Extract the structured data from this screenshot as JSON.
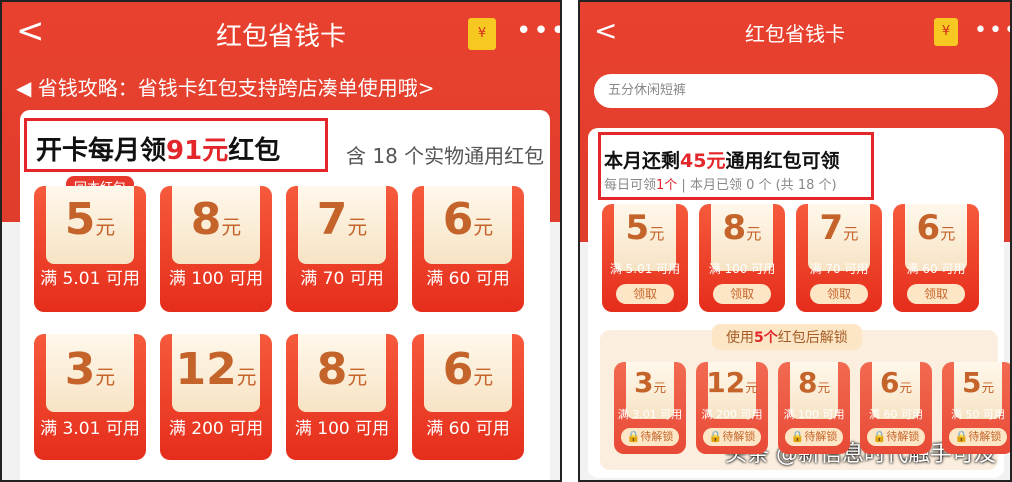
{
  "left": {
    "title": "红包省钱卡",
    "back": "<",
    "redbag": "¥",
    "menu": "•••",
    "tip": "◀︎ 省钱攻略：省钱卡红包支持跨店凑单使用哦>",
    "headline_pre": "开卡每月领",
    "headline_amount": "91元",
    "headline_post": "红包",
    "includes": "含 18 个实物通用红包",
    "tag": "回本红包",
    "row1": [
      {
        "amount": "5",
        "unit": "元",
        "cond": "满 5.01 可用"
      },
      {
        "amount": "8",
        "unit": "元",
        "cond": "满 100 可用"
      },
      {
        "amount": "7",
        "unit": "元",
        "cond": "满 70 可用"
      },
      {
        "amount": "6",
        "unit": "元",
        "cond": "满 60 可用"
      }
    ],
    "row2": [
      {
        "amount": "3",
        "unit": "元",
        "cond": "满 3.01 可用"
      },
      {
        "amount": "12",
        "unit": "元",
        "cond": "满 200 可用"
      },
      {
        "amount": "8",
        "unit": "元",
        "cond": "满 100 可用"
      },
      {
        "amount": "6",
        "unit": "元",
        "cond": "满 60 可用"
      }
    ]
  },
  "right": {
    "title": "红包省钱卡",
    "back": "<",
    "redbag": "¥",
    "menu": "•••",
    "search_placeholder": "五分休闲短裤",
    "remain_pre": "本月还剩",
    "remain_amount": "45元",
    "remain_post": "通用红包可领",
    "daily_pre": "每日可领",
    "daily_count": "1个",
    "daily_post": " | 本月已领 0 个 (共 18 个)",
    "claim_label": "领取",
    "unlock_pre": "使用",
    "unlock_count": "5个",
    "unlock_post": "红包后解锁",
    "locked_label": "待解锁",
    "row1": [
      {
        "amount": "5",
        "unit": "元",
        "cond": "满 5.01 可用"
      },
      {
        "amount": "8",
        "unit": "元",
        "cond": "满 100 可用"
      },
      {
        "amount": "7",
        "unit": "元",
        "cond": "满 70 可用"
      },
      {
        "amount": "6",
        "unit": "元",
        "cond": "满 60 可用"
      }
    ],
    "row2": [
      {
        "amount": "3",
        "unit": "元",
        "cond": "满 3.01 可用"
      },
      {
        "amount": "12",
        "unit": "元",
        "cond": "满 200 可用"
      },
      {
        "amount": "8",
        "unit": "元",
        "cond": "满 100 可用"
      },
      {
        "amount": "6",
        "unit": "元",
        "cond": "满 60 可用"
      },
      {
        "amount": "5",
        "unit": "元",
        "cond": "满 50 可用"
      }
    ]
  },
  "watermark": "头条 @新信息时代触手可及",
  "colors": {
    "header_red": "#e9412f",
    "highlight": "#e2262a",
    "coupon_red": "#e52d1b",
    "gold": "#c5642a"
  }
}
